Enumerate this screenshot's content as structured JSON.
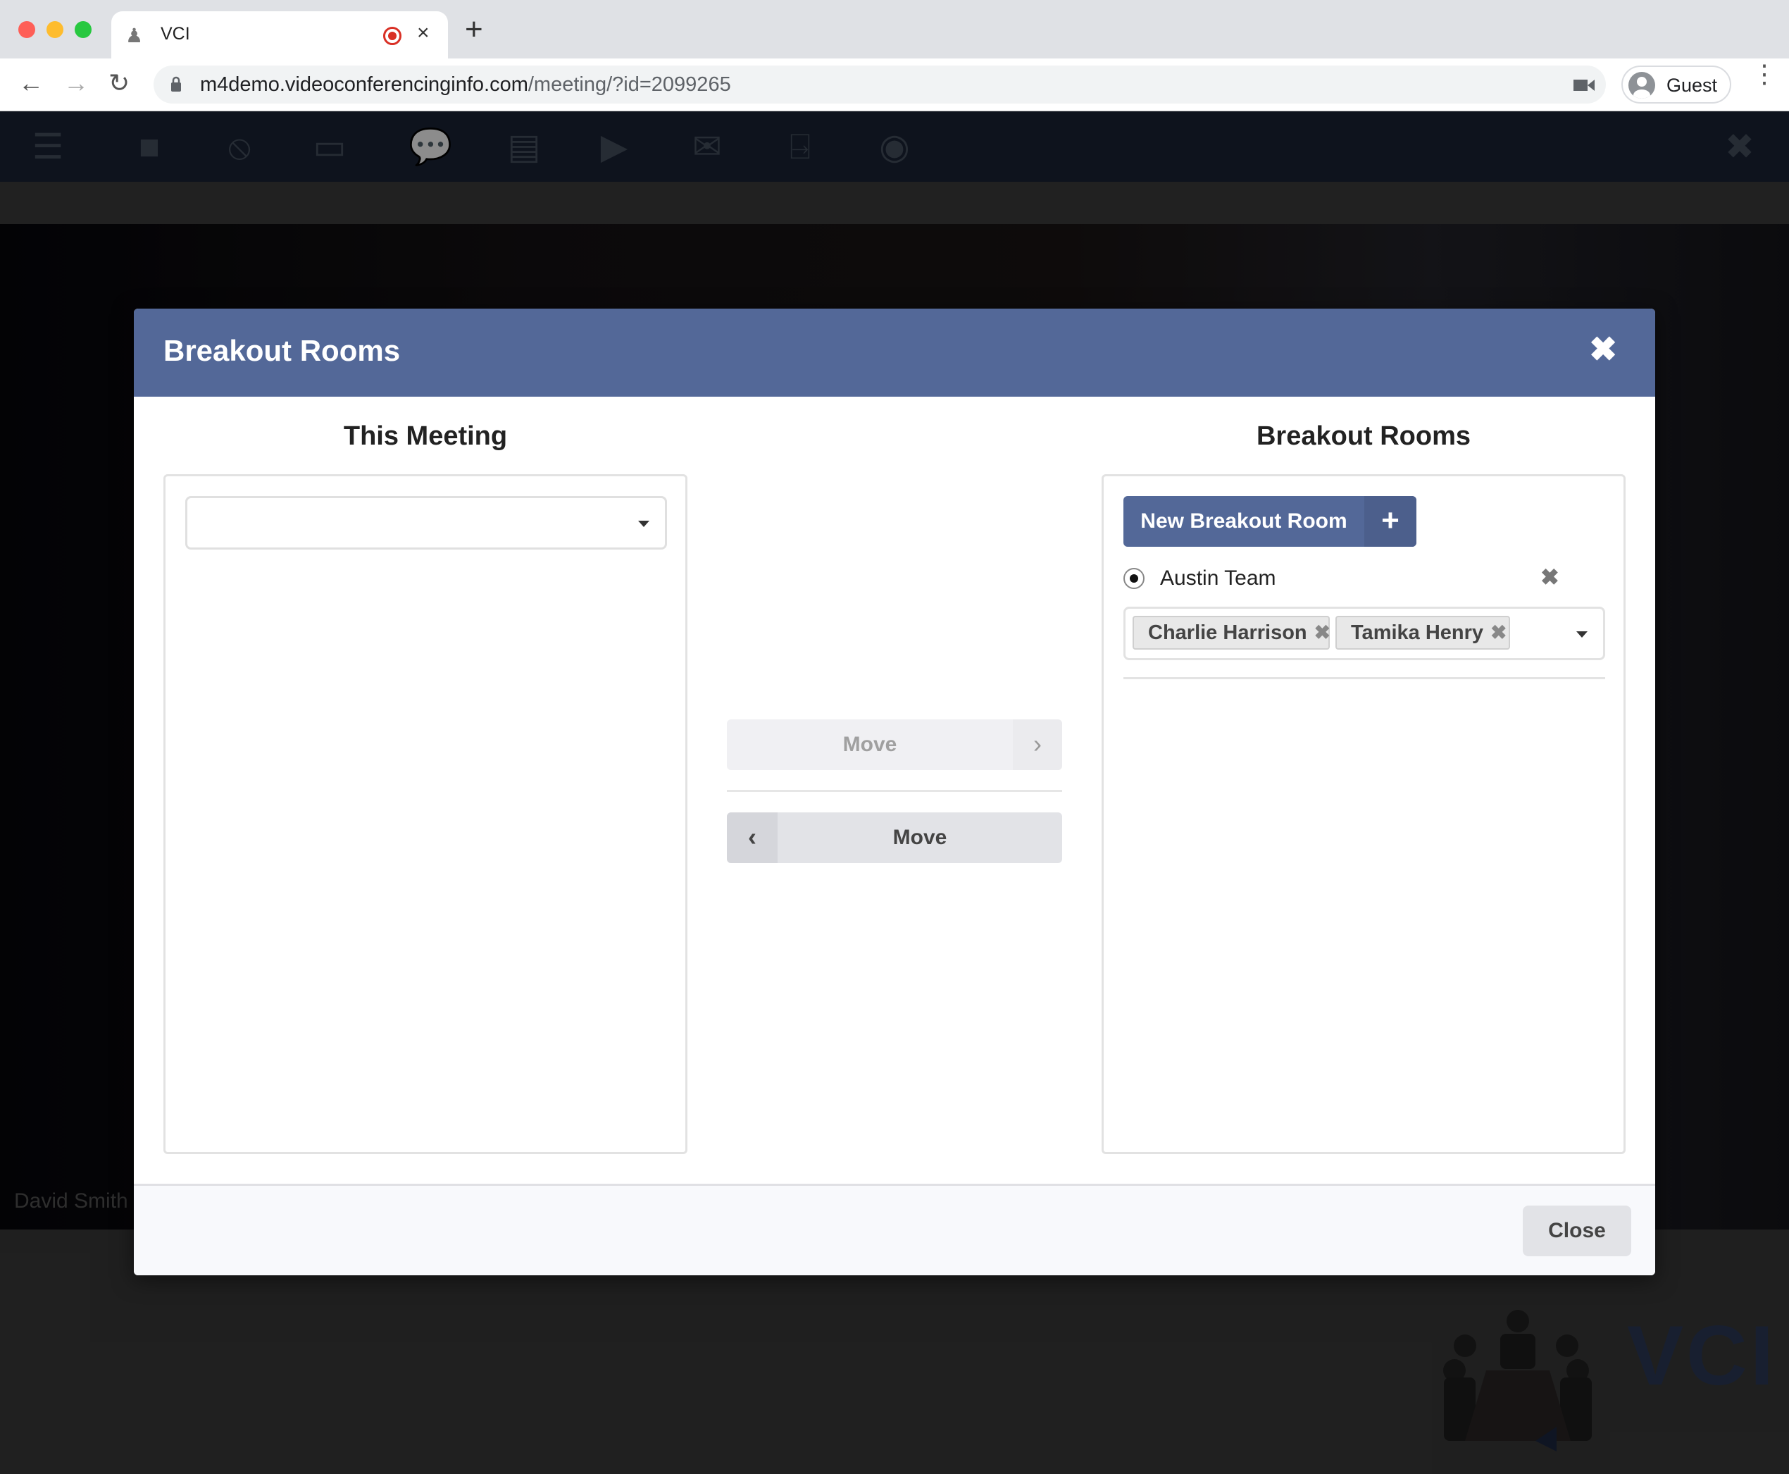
{
  "browser": {
    "tab_title": "VCI",
    "tab_close": "×",
    "new_tab": "+",
    "url_host": "m4demo.videoconferencinginfo.com",
    "url_path": "/meeting/?id=2099265",
    "profile_label": "Guest",
    "nav": {
      "back": "←",
      "forward": "→",
      "reload": "↻"
    },
    "menu": "⋮"
  },
  "app": {
    "toolbar": [
      {
        "name": "menu-icon",
        "glyph": "☰"
      },
      {
        "name": "camera-icon",
        "glyph": "■"
      },
      {
        "name": "mic-muted-icon",
        "glyph": "⦸"
      },
      {
        "name": "screen-share-icon",
        "glyph": "▭"
      },
      {
        "name": "chat-icon",
        "glyph": "💬"
      },
      {
        "name": "document-icon",
        "glyph": "▤"
      },
      {
        "name": "media-play-icon",
        "glyph": "▶"
      },
      {
        "name": "mail-icon",
        "glyph": "✉"
      },
      {
        "name": "exit-door-icon",
        "glyph": "⍈"
      },
      {
        "name": "record-icon",
        "glyph": "◉"
      }
    ],
    "toolbar_close": "✖",
    "participant_name": "David Smith",
    "logo_text": "VCI"
  },
  "modal": {
    "title": "Breakout Rooms",
    "close_glyph": "✖",
    "left_column_title": "This Meeting",
    "right_column_title": "Breakout Rooms",
    "left_select_value": "",
    "new_room_label": "New Breakout Room",
    "new_room_plus": "+",
    "rooms": [
      {
        "name": "Austin Team",
        "selected": true,
        "delete_glyph": "✖",
        "members": [
          "Charlie Harrison",
          "Tamika Henry"
        ]
      }
    ],
    "chip_remove_glyph": "✖",
    "move_right_label": "Move",
    "move_right_glyph": "›",
    "move_left_label": "Move",
    "move_left_glyph": "‹",
    "close_button": "Close"
  },
  "colors": {
    "modal_header": "#536898",
    "primary_button": "#536898"
  }
}
